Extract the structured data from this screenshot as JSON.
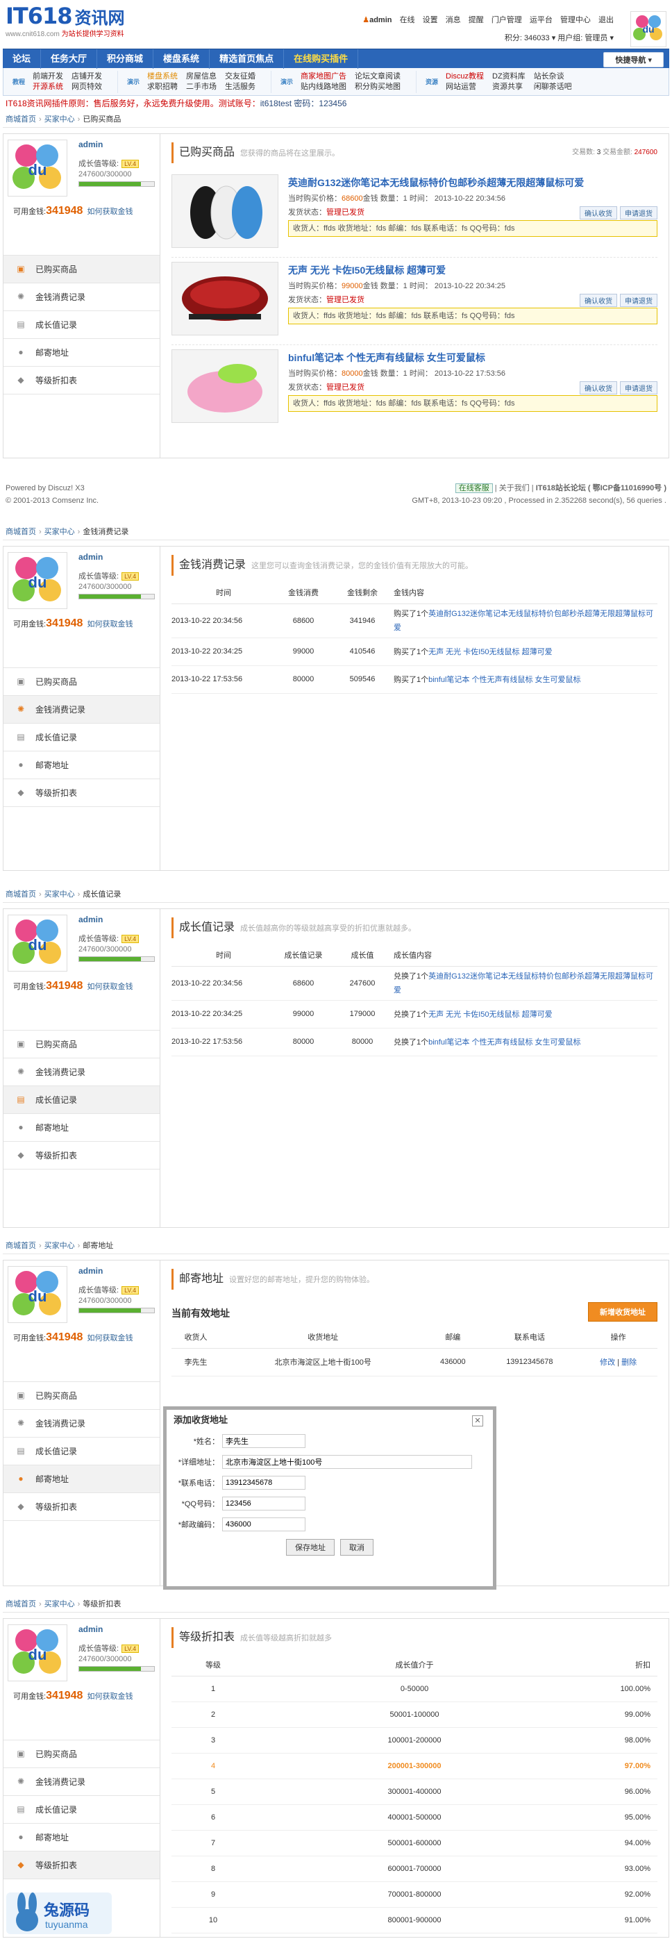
{
  "header": {
    "logo_main": "IT618",
    "logo_cn": "资讯网",
    "logo_sub_domain": "www.cnit618.com",
    "logo_sub_slogan": "为站长提供学习资料",
    "user": "admin",
    "links": [
      "在线",
      "设置",
      "消息",
      "提醒",
      "门户管理",
      "运平台",
      "管理中心",
      "退出"
    ],
    "points": "积分: 346033",
    "usergroup": "用户组: 管理员"
  },
  "nav": {
    "items": [
      "论坛",
      "任务大厅",
      "积分商城",
      "楼盘系统",
      "精选首页焦点",
      "在线购买插件"
    ],
    "quick": "快捷导航"
  },
  "subnav": [
    {
      "icon": "教程",
      "cols": [
        [
          "前端开发",
          "开源系统"
        ],
        [
          "店铺开发",
          "网页特效"
        ]
      ]
    },
    {
      "icon": "演示",
      "cols": [
        [
          "楼盘系统",
          "求职招聘"
        ],
        [
          "房屋信息",
          "二手市场"
        ],
        [
          "交友征婚",
          "生活服务"
        ]
      ]
    },
    {
      "icon": "演示",
      "cols": [
        [
          "商家地图广告",
          "贴内线路地图"
        ],
        [
          "论坛文章阅读",
          "积分购买地图"
        ]
      ]
    },
    {
      "icon": "资源",
      "cols": [
        [
          "Discuz教程",
          "网站运营"
        ],
        [
          "DZ资料库",
          "资源共享"
        ],
        [
          "站长杂谈",
          "闲聊茶话吧"
        ]
      ]
    }
  ],
  "notice": {
    "text": "IT618资讯网插件原则：售后服务好，永远免费升级使用。测试账号：",
    "account": "it618test 密码：123456"
  },
  "profile": {
    "name": "admin",
    "level_label": "成长值等级:",
    "level_badge": "LV.4",
    "growth": "247600/300000",
    "growth_ratio": 0.825,
    "money_label": "可用金钱:",
    "money": "341948",
    "money_link": "如何获取金钱"
  },
  "menu": [
    "已购买商品",
    "金钱消费记录",
    "成长值记录",
    "邮寄地址",
    "等级折扣表"
  ],
  "crumb_home": "商城首页",
  "crumb_center": "买家中心",
  "section1": {
    "crumb": "已购买商品",
    "title": "已购买商品",
    "desc": "您获得的商品将在这里展示。",
    "stat_count_label": "交易数:",
    "stat_count": "3",
    "stat_money_label": "交易金额:",
    "stat_money": "247600",
    "goods": [
      {
        "title": "英迪耐G132迷你笔记本无线鼠标特价包邮秒杀超薄无限超薄鼠标可爱",
        "price": "68600",
        "date": "2013-10-22 20:34:56",
        "status": "管理已发货",
        "btn1": "确认收货",
        "btn2": "申请退货"
      },
      {
        "title": "无声 无光 卡佐I50无线鼠标 超薄可爱",
        "price": "99000",
        "date": "2013-10-22 20:34:25",
        "status": "管理已发货",
        "btn1": "确认收货",
        "btn2": "申请退货"
      },
      {
        "title": "binful笔记本 个性无声有线鼠标 女生可爱鼠标",
        "price": "80000",
        "date": "2013-10-22 17:53:56",
        "status": "管理已发货",
        "btn1": "确认收货",
        "btn2": "申请退货"
      }
    ],
    "price_label": "当时购买价格：",
    "price_unit": "金钱 数量：1 时间：",
    "status_label": "发货状态：",
    "delivery": "收货人：ffds 收货地址：fds 邮编：fds 联系电话：fs QQ号码：fds"
  },
  "footer": {
    "powered": "Powered by Discuz! X3",
    "copyright": "© 2001-2013 Comsenz Inc.",
    "online": "在线客服",
    "about": "关于我们",
    "site": "IT618站长论坛 ( 鄂ICP备11016990号 )",
    "gmt": "GMT+8, 2013-10-23 09:20 , Processed in 2.352268 second(s), 56 queries ."
  },
  "section2": {
    "crumb": "金钱消费记录",
    "title": "金钱消费记录",
    "desc": "这里您可以查询金钱消费记录，您的金钱价值有无限放大的可能。",
    "headers": [
      "时间",
      "金钱消费",
      "金钱剩余",
      "金钱内容"
    ],
    "rows": [
      {
        "time": "2013-10-22 20:34:56",
        "a": "68600",
        "b": "341946",
        "pre": "购买了1个",
        "link": "英迪耐G132迷你笔记本无线鼠标特价包邮秒杀超薄无限超薄鼠标可爱"
      },
      {
        "time": "2013-10-22 20:34:25",
        "a": "99000",
        "b": "410546",
        "pre": "购买了1个",
        "link": "无声 无光 卡佐I50无线鼠标 超薄可爱"
      },
      {
        "time": "2013-10-22 17:53:56",
        "a": "80000",
        "b": "509546",
        "pre": "购买了1个",
        "link": "binful笔记本 个性无声有线鼠标 女生可爱鼠标"
      }
    ]
  },
  "section3": {
    "crumb": "成长值记录",
    "title": "成长值记录",
    "desc": "成长值越高你的等级就越高享受的折扣优惠就越多。",
    "headers": [
      "时间",
      "成长值记录",
      "成长值",
      "成长值内容"
    ],
    "rows": [
      {
        "time": "2013-10-22 20:34:56",
        "a": "68600",
        "b": "247600",
        "pre": "兑换了1个",
        "link": "英迪耐G132迷你笔记本无线鼠标特价包邮秒杀超薄无限超薄鼠标可爱"
      },
      {
        "time": "2013-10-22 20:34:25",
        "a": "99000",
        "b": "179000",
        "pre": "兑换了1个",
        "link": "无声 无光 卡佐I50无线鼠标 超薄可爱"
      },
      {
        "time": "2013-10-22 17:53:56",
        "a": "80000",
        "b": "80000",
        "pre": "兑换了1个",
        "link": "binful笔记本 个性无声有线鼠标 女生可爱鼠标"
      }
    ]
  },
  "section4": {
    "crumb": "邮寄地址",
    "title": "邮寄地址",
    "desc": "设置好您的邮寄地址，提升您的购物体验。",
    "current": "当前有效地址",
    "add_btn": "新增收货地址",
    "headers": [
      "收货人",
      "收货地址",
      "邮编",
      "联系电话",
      "操作"
    ],
    "row": {
      "name": "李先生",
      "addr": "北京市海淀区上地十街100号",
      "zip": "436000",
      "phone": "13912345678",
      "edit": "修改",
      "del": "删除"
    },
    "dialog": {
      "title": "添加收货地址",
      "close": "✕",
      "fields": [
        {
          "label": "*姓名：",
          "value": "李先生"
        },
        {
          "label": "*详细地址：",
          "value": "北京市海淀区上地十街100号"
        },
        {
          "label": "*联系电话：",
          "value": "13912345678"
        },
        {
          "label": "*QQ号码：",
          "value": "123456"
        },
        {
          "label": "*邮政编码：",
          "value": "436000"
        }
      ],
      "save": "保存地址",
      "cancel": "取消"
    }
  },
  "section5": {
    "crumb": "等级折扣表",
    "title": "等级折扣表",
    "desc": "成长值等级越高折扣就越多",
    "headers": [
      "等级",
      "成长值介于",
      "折扣"
    ],
    "rows": [
      [
        "1",
        "0-50000",
        "100.00%"
      ],
      [
        "2",
        "50001-100000",
        "99.00%"
      ],
      [
        "3",
        "100001-200000",
        "98.00%"
      ],
      [
        "4",
        "200001-300000",
        "97.00%"
      ],
      [
        "5",
        "300001-400000",
        "96.00%"
      ],
      [
        "6",
        "400001-500000",
        "95.00%"
      ],
      [
        "7",
        "500001-600000",
        "94.00%"
      ],
      [
        "8",
        "600001-700000",
        "93.00%"
      ],
      [
        "9",
        "700001-800000",
        "92.00%"
      ],
      [
        "10",
        "800001-900000",
        "91.00%"
      ]
    ],
    "highlight_row": 3
  },
  "watermark": {
    "cn": "兔源码",
    "en": "tuyuanma"
  },
  "colors": {
    "nav_blue": "#2b66b8",
    "accent_orange": "#e67e22",
    "price_orange": "#e06000"
  }
}
